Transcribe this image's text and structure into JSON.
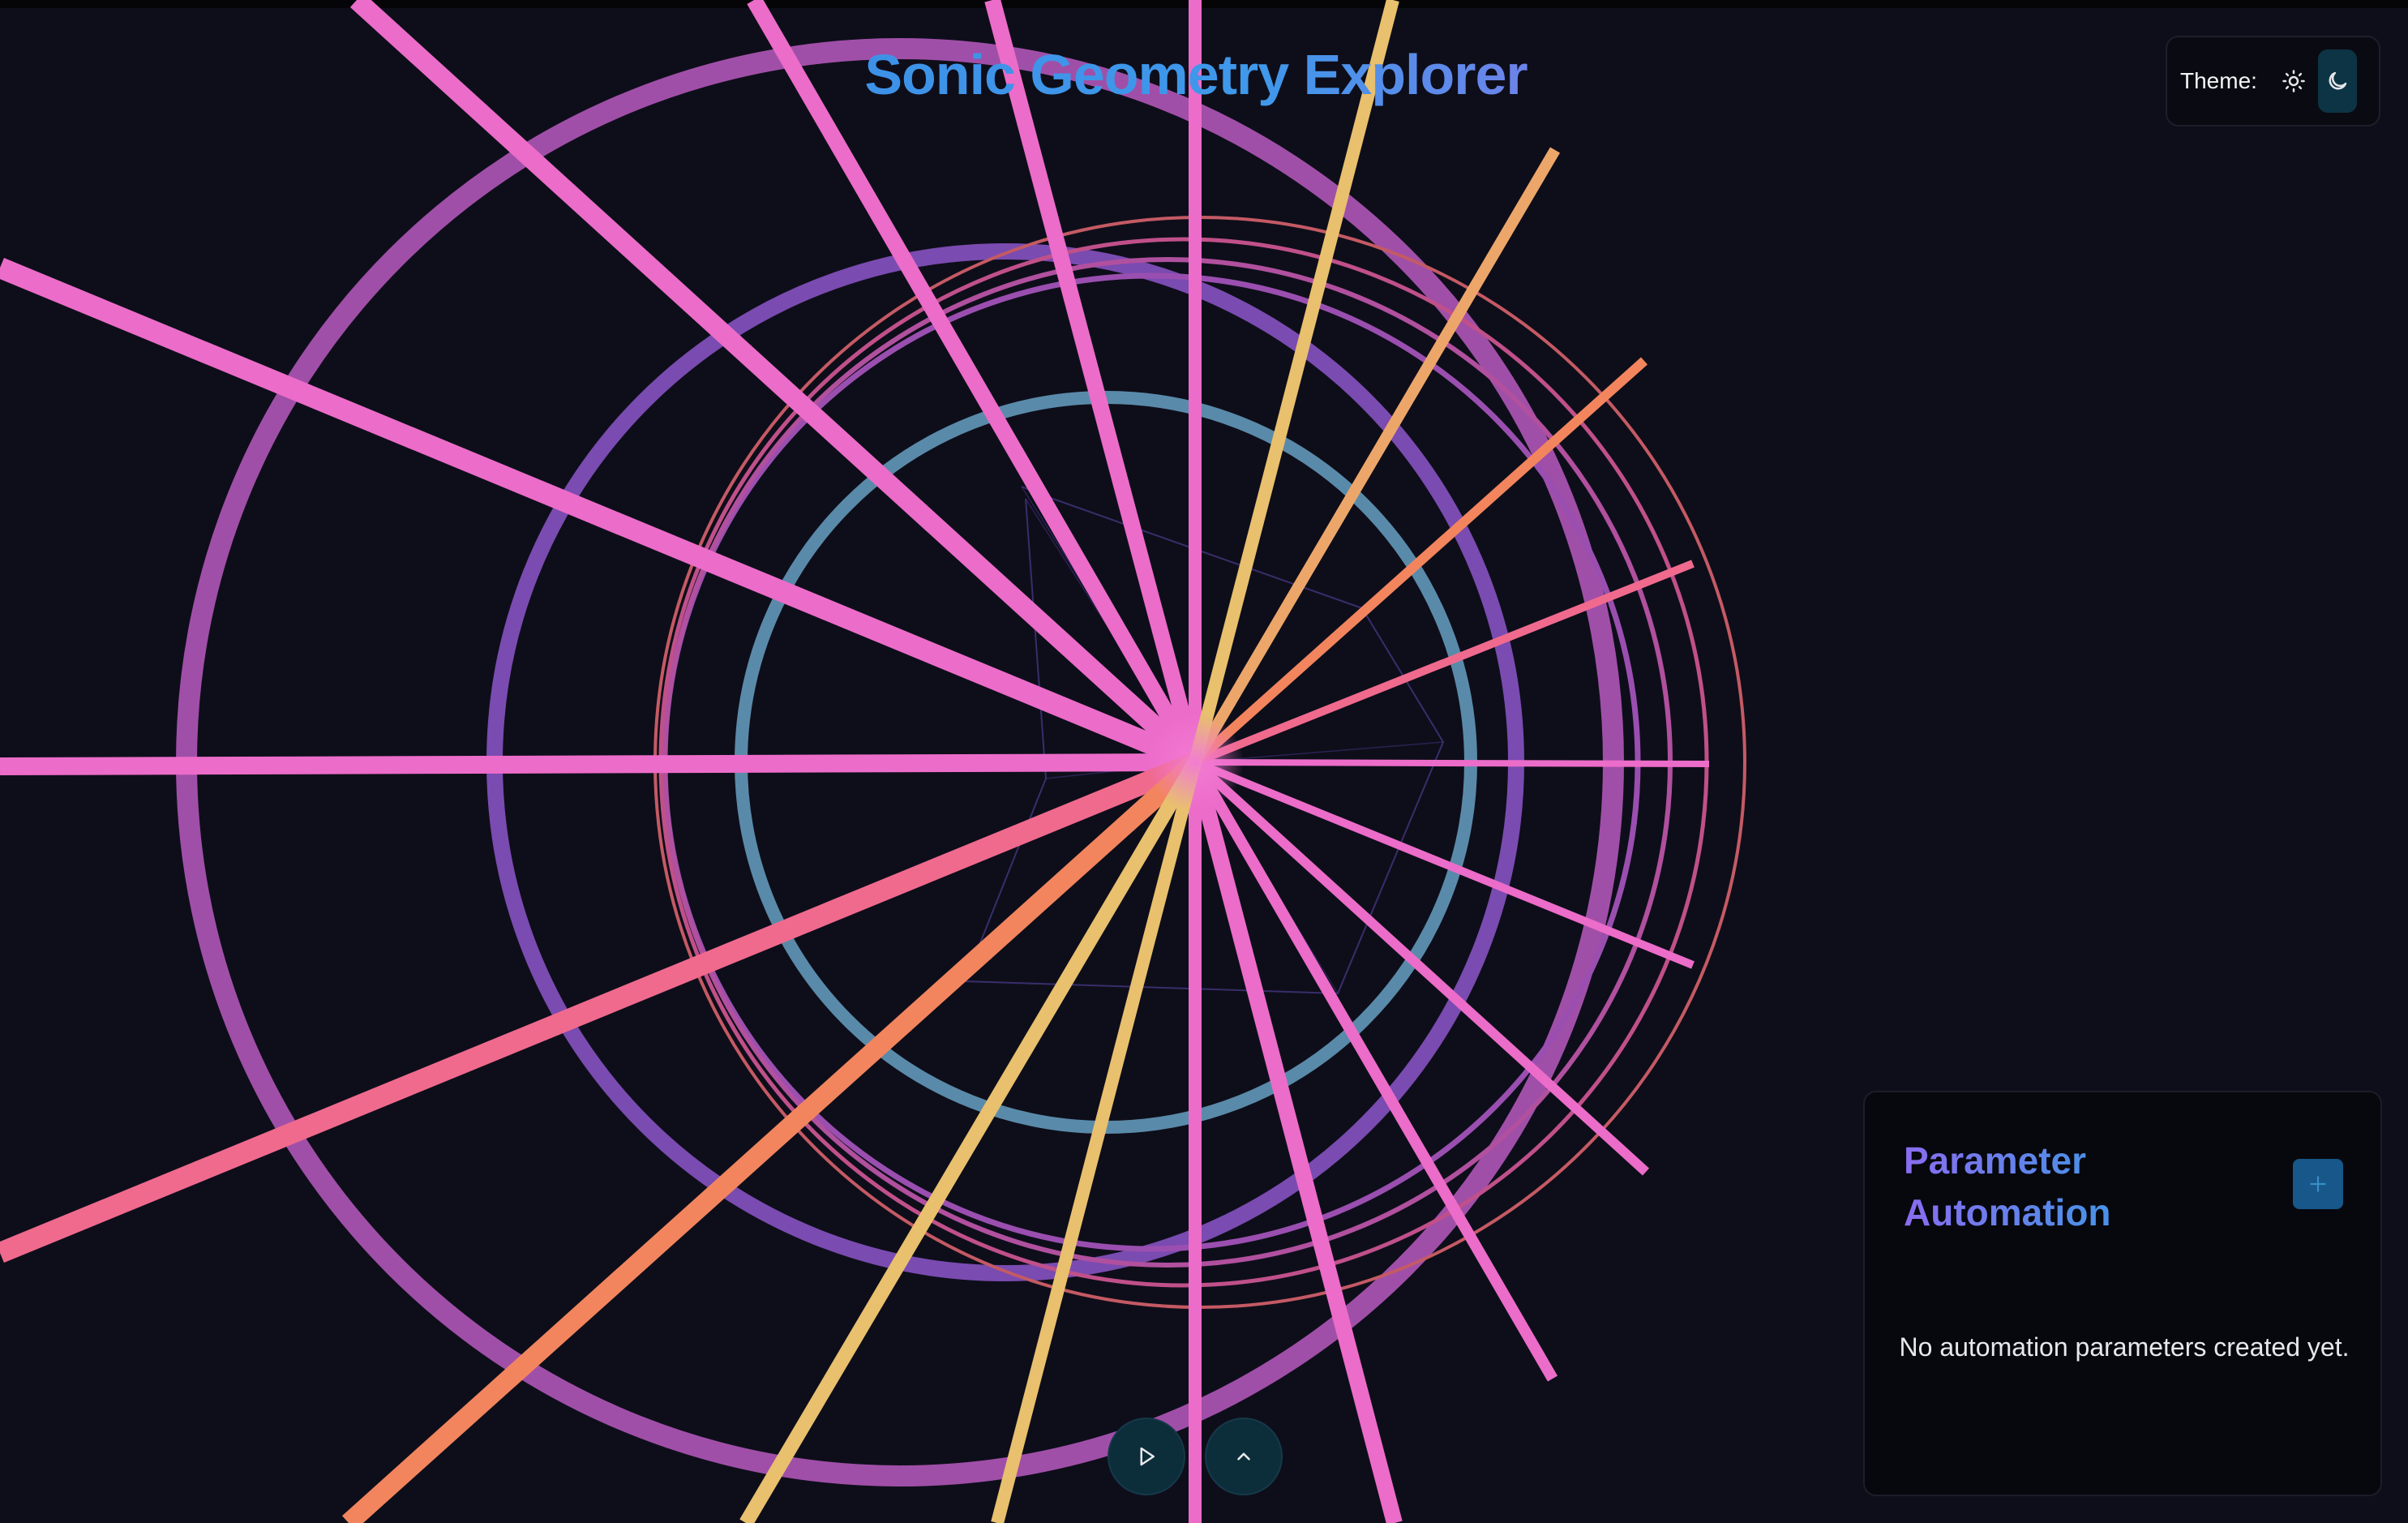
{
  "header": {
    "title": "Sonic Geometry Explorer"
  },
  "theme": {
    "label": "Theme:",
    "options": [
      {
        "name": "light",
        "icon": "sun-icon",
        "active": false
      },
      {
        "name": "dark",
        "icon": "moon-icon",
        "active": true
      }
    ]
  },
  "automation": {
    "title": "Parameter Automation",
    "add_icon": "plus-icon",
    "empty_message": "No automation parameters created yet."
  },
  "controls": {
    "play_icon": "play-icon",
    "expand_icon": "chevron-up-icon"
  },
  "colors": {
    "background": "#0e0e1a",
    "pink": "#ec6cc9",
    "orange": "#f2855e",
    "yellow": "#e8c06e",
    "purple": "#7a4bb0",
    "teal": "#5a8aa9",
    "accent": "#3b8fe3"
  }
}
